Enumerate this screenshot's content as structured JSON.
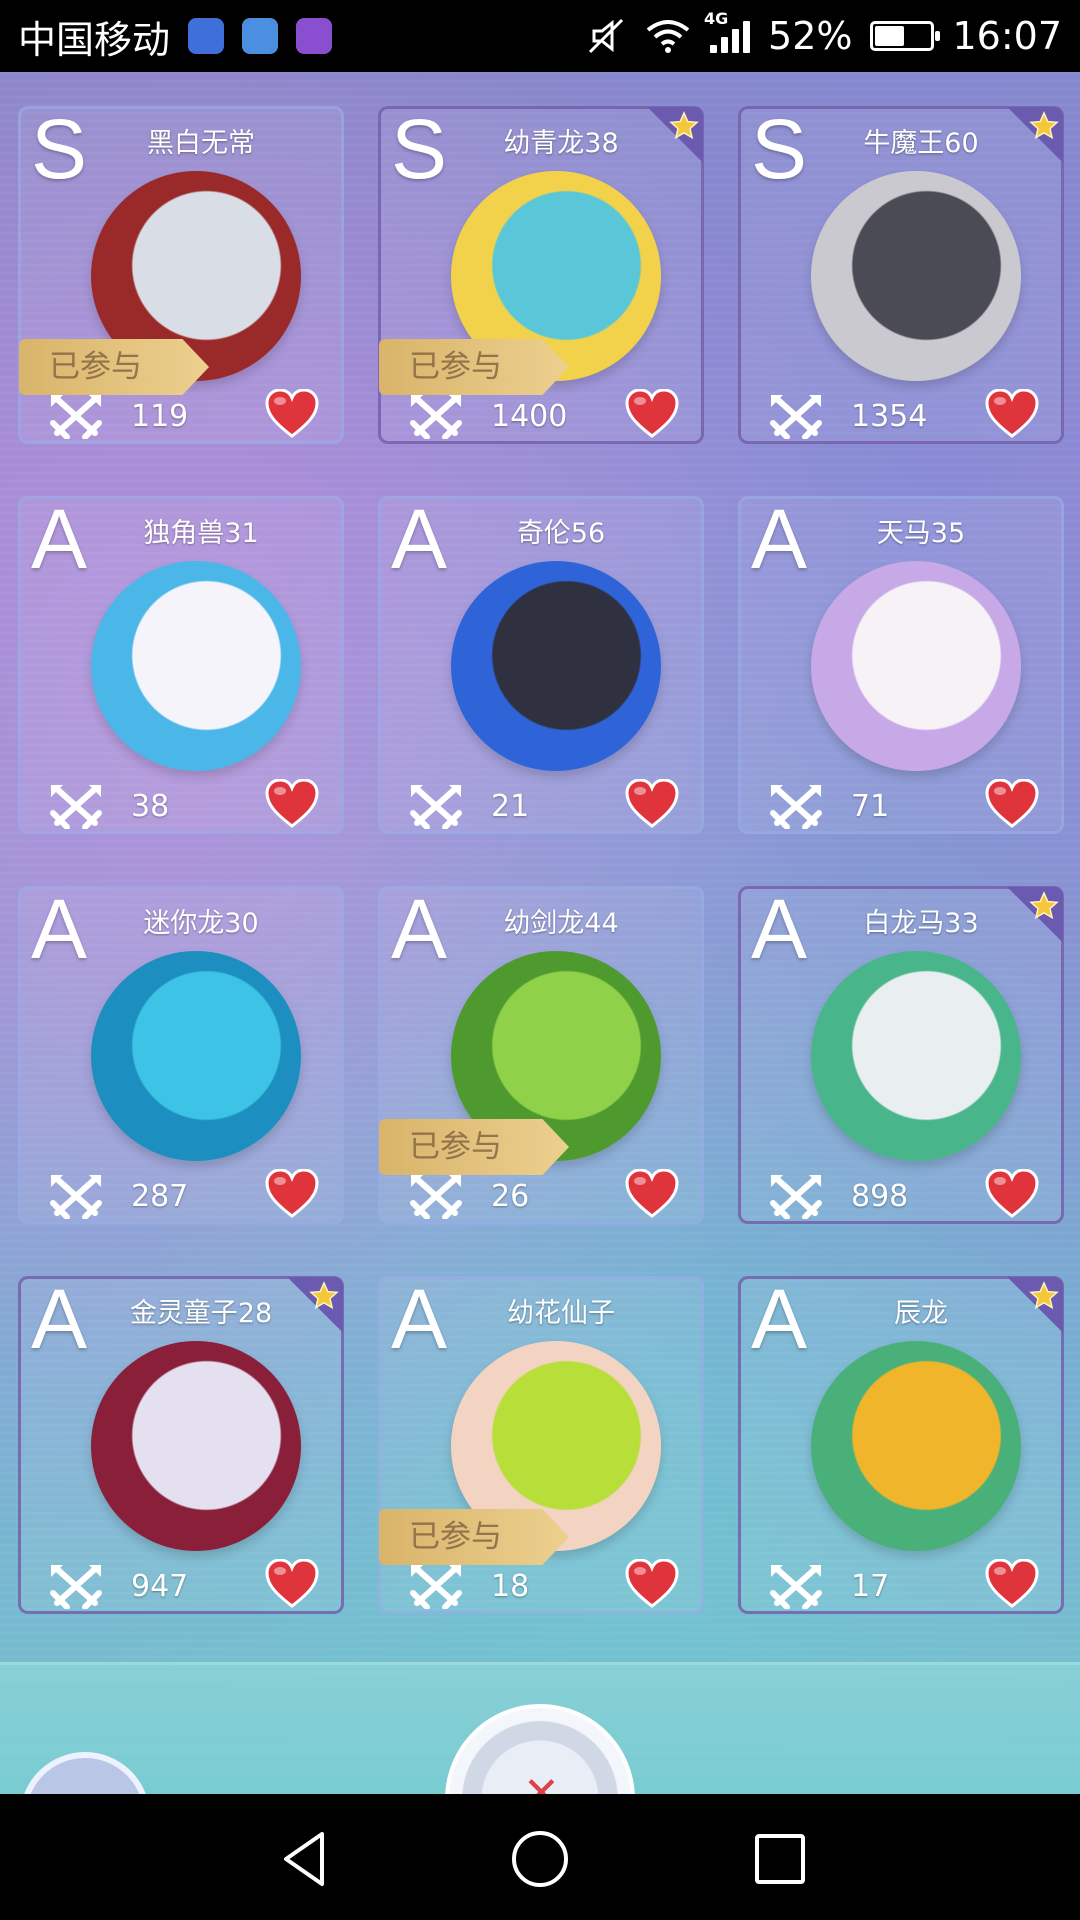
{
  "statusbar": {
    "carrier": "中国移动",
    "network": "4G",
    "battery": "52%",
    "battery_level": 0.52,
    "time": "16:07"
  },
  "cards": [
    {
      "grade": "S",
      "name": "黑白无常",
      "power": "119",
      "joined_label": "已参与",
      "starred": false,
      "joined": true,
      "colors": [
        "#d9dde6",
        "#9a2a2a"
      ]
    },
    {
      "grade": "S",
      "name": "幼青龙38",
      "power": "1400",
      "joined_label": "已参与",
      "starred": true,
      "joined": true,
      "colors": [
        "#5ac7d8",
        "#f2d24a"
      ]
    },
    {
      "grade": "S",
      "name": "牛魔王60",
      "power": "1354",
      "joined_label": "",
      "starred": true,
      "joined": false,
      "colors": [
        "#4b4b55",
        "#c9c9cf"
      ]
    },
    {
      "grade": "A",
      "name": "独角兽31",
      "power": "38",
      "joined_label": "",
      "starred": false,
      "joined": false,
      "colors": [
        "#f4f4fa",
        "#4bb6e8"
      ]
    },
    {
      "grade": "A",
      "name": "奇伦56",
      "power": "21",
      "joined_label": "",
      "starred": false,
      "joined": false,
      "colors": [
        "#2f3140",
        "#2f64d8"
      ]
    },
    {
      "grade": "A",
      "name": "天马35",
      "power": "71",
      "joined_label": "",
      "starred": false,
      "joined": false,
      "colors": [
        "#f7f2f6",
        "#c6a9e6"
      ]
    },
    {
      "grade": "A",
      "name": "迷你龙30",
      "power": "287",
      "joined_label": "",
      "starred": false,
      "joined": false,
      "colors": [
        "#3cc3e6",
        "#1c8fc0"
      ]
    },
    {
      "grade": "A",
      "name": "幼剑龙44",
      "power": "26",
      "joined_label": "已参与",
      "starred": false,
      "joined": true,
      "colors": [
        "#8fd24a",
        "#4f9a2e"
      ]
    },
    {
      "grade": "A",
      "name": "白龙马33",
      "power": "898",
      "joined_label": "",
      "starred": true,
      "joined": false,
      "colors": [
        "#e9eef0",
        "#49b58a"
      ]
    },
    {
      "grade": "A",
      "name": "金灵童子28",
      "power": "947",
      "joined_label": "",
      "starred": true,
      "joined": false,
      "colors": [
        "#e4e0ef",
        "#8a1f3a"
      ]
    },
    {
      "grade": "A",
      "name": "幼花仙子",
      "power": "18",
      "joined_label": "已参与",
      "starred": false,
      "joined": true,
      "colors": [
        "#b8de3a",
        "#f3d3c2"
      ]
    },
    {
      "grade": "A",
      "name": "辰龙",
      "power": "17",
      "joined_label": "",
      "starred": true,
      "joined": false,
      "colors": [
        "#f0b52a",
        "#49b07a"
      ]
    }
  ],
  "icons": {
    "power": "crossed-swords-icon",
    "like": "heart-icon",
    "favorite": "star-icon"
  }
}
